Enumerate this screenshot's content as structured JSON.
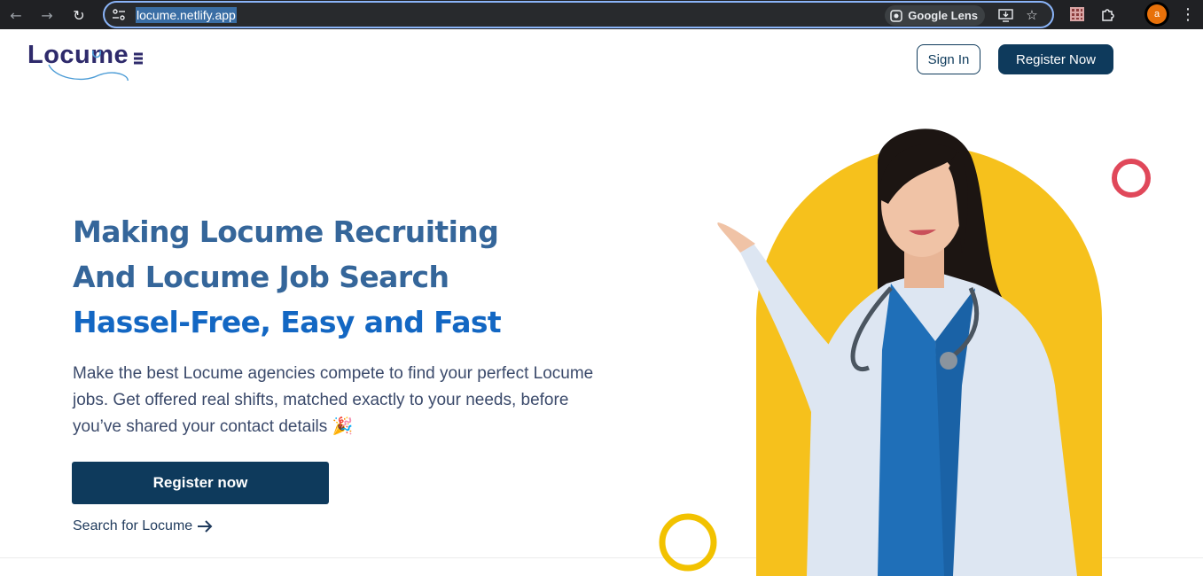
{
  "browser": {
    "url": "locume.netlify.app",
    "lens_label": "Google Lens",
    "profile_initial": "a"
  },
  "header": {
    "logo_text": "Locume",
    "signin_label": "Sign In",
    "register_label": "Register Now"
  },
  "hero": {
    "headline_line1": "Making Locume Recruiting",
    "headline_line2": "And Locume Job Search",
    "headline_line3": "Hassel-Free, Easy and Fast",
    "subtext": "Make the best Locume agencies compete to find your perfect Locume jobs. Get offered real shifts, matched exactly to your needs, before you’ve shared your contact details 🎉",
    "cta_label": "Register now",
    "search_link_label": "Search for Locume"
  },
  "colors": {
    "navy": "#0e3a5c",
    "headline_blue": "#35669a",
    "headline_bright": "#1367c3",
    "arch_yellow": "#f6c11c",
    "ring_red": "#e0485a",
    "ring_yellow": "#f2c200"
  }
}
